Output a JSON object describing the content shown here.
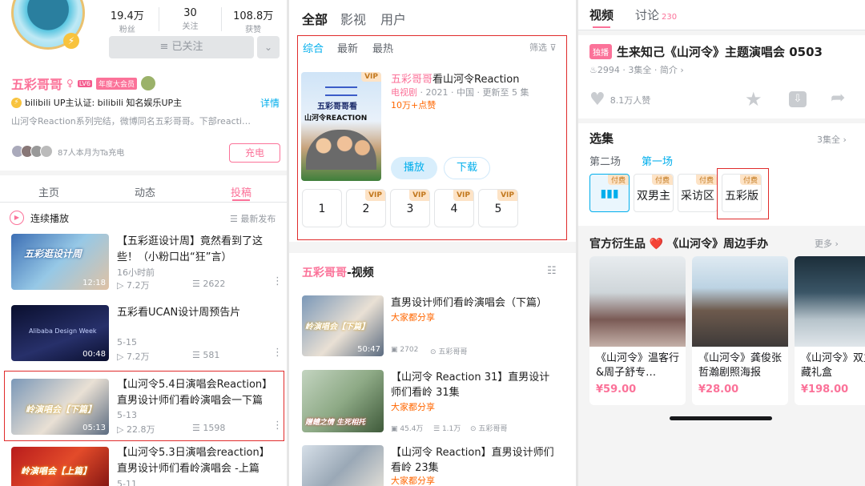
{
  "p1": {
    "stats": [
      {
        "value": "19.4万",
        "label": "粉丝"
      },
      {
        "value": "30",
        "label": "关注"
      },
      {
        "value": "108.8万",
        "label": "获赞"
      }
    ],
    "followed": "≡ 已关注",
    "name": "五彩哥哥",
    "level": "LV6",
    "member": "年度大会员",
    "cert": "bilibili  UP主认证: bilibili  知名娱乐UP主",
    "detail": "详情",
    "bio": "山河令Reaction系列完结，微博同名五彩哥哥。下部reacti…",
    "charge_text": "87人本月为Ta充电",
    "charge_btn": "充电",
    "tabs": [
      "主页",
      "动态",
      "投稿"
    ],
    "autoplay": "连续播放",
    "sort": "☰ 最新发布",
    "videos": [
      {
        "title": "【五彩逛设计周】竟然看到了这些！（小粉口出“狂”言）",
        "time": "16小时前",
        "views": "7.2万",
        "danmaku": "2622",
        "dur": "12:18",
        "thumb": "五彩逛设计周"
      },
      {
        "title": "五彩看UCAN设计周预告片",
        "time": "5-15",
        "views": "7.2万",
        "danmaku": "581",
        "dur": "00:48",
        "thumb": "Alibaba Design Week"
      },
      {
        "title": "【山河令5.4日演唱会Reaction】直男设计师们看岭演唱会一下篇",
        "time": "5-13",
        "views": "22.8万",
        "danmaku": "1598",
        "dur": "05:13",
        "thumb": "岭演唱会【下篇】"
      },
      {
        "title": "【山河令5.3日演唱会reaction】直男设计师们看岭演唱会 -上篇",
        "time": "5-11",
        "views": "",
        "danmaku": "",
        "dur": "",
        "thumb": "岭演唱会【上篇】"
      }
    ]
  },
  "p2": {
    "tabs": [
      "全部",
      "影视",
      "用户"
    ],
    "filters": [
      "综合",
      "最新",
      "最热"
    ],
    "filter_btn": "筛选",
    "result_title_pink": "五彩哥哥",
    "result_title_rest": "看山河令Reaction",
    "result_meta_type": "电视剧",
    "result_meta": " · 2021 · 中国 · 更新至 5 集",
    "result_views": "10万+点赞",
    "cover_text1": "五彩哥哥看",
    "cover_text2": "山河令REACTION",
    "vip": "VIP",
    "play": "播放",
    "download": "下载",
    "episodes": [
      "1",
      "2",
      "3",
      "4",
      "5"
    ],
    "section_pink": "五彩哥哥",
    "section_rest": "-视频",
    "videos": [
      {
        "title": "直男设计师们看岭演唱会（下篇）",
        "tag": "大家都分享",
        "views": "2702",
        "author": "五彩哥哥",
        "dur": "50:47",
        "thumb": "岭演唱会【下篇】"
      },
      {
        "title": "【山河令 Reaction 31】直男设计师们看岭 31集",
        "tag": "大家都分享",
        "views": "45.4万",
        "danmaku": "1.1万",
        "author": "五彩哥哥",
        "thumb": "赠鳢之情 生死相托"
      },
      {
        "title": "【山河令 Reaction】直男设计师们看岭 23集",
        "tag": "大家都分享",
        "thumb": ""
      }
    ]
  },
  "p3": {
    "tabs": [
      "视频",
      "讨论"
    ],
    "discuss_count": "230",
    "badge": "独播",
    "title": "生来知己《山河令》主题演唱会 0503",
    "meta_views": "2994",
    "meta_eps": "· 3集全 ·",
    "meta_intro": "简介 ›",
    "likes": "8.1万人赞",
    "select_title": "选集",
    "select_all": "3集全 ›",
    "season": "第二场",
    "season_active": "第一场",
    "paid": "付费",
    "eps": [
      "",
      "双男主",
      "采访区",
      "五彩版"
    ],
    "merch_title": "官方衍生品 ❤️ 《山河令》周边手办",
    "more": "更多 ›",
    "products": [
      {
        "title": "《山河令》温客行&周子舒专…",
        "price": "¥59.00"
      },
      {
        "title": "《山河令》龚俊张哲瀚剧照海报",
        "price": "¥28.00"
      },
      {
        "title": "《山河令》双主珍藏礼盒",
        "price": "¥198.00"
      }
    ]
  },
  "colors": {
    "pink": "#fb7299",
    "blue": "#00aeec",
    "red": "#e02b2b"
  }
}
